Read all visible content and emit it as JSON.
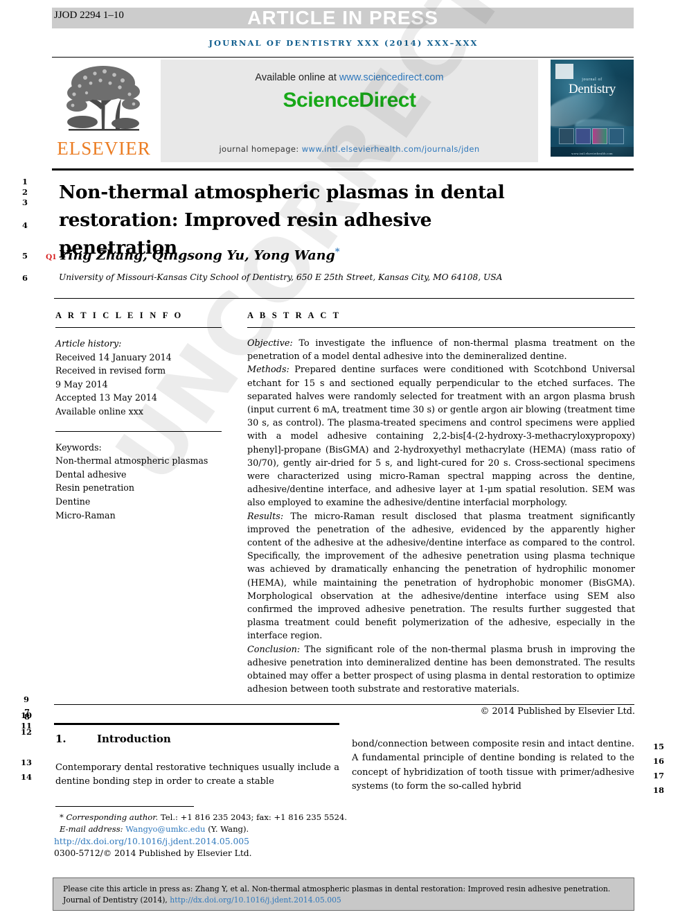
{
  "header": {
    "running_id": "JJOD 2294 1–10",
    "article_in_press": "ARTICLE IN PRESS",
    "journal_running_head": "JOURNAL OF DENTISTRY XXX (2014) XXX–XXX"
  },
  "masthead": {
    "publisher_name": "ELSEVIER",
    "available_text": "Available online at",
    "sciencedirect_url": "www.sciencedirect.com",
    "sciencedirect_logo": "ScienceDirect",
    "homepage_label": "journal homepage:",
    "homepage_url": "www.intl.elsevierhealth.com/journals/jden",
    "cover_journal_sup": "journal of",
    "cover_journal_name": "Dentistry",
    "cover_footer": "www.intl.elsevierhealth.com"
  },
  "article": {
    "title": "Non-thermal atmospheric plasmas in dental restoration: Improved resin adhesive penetration",
    "query_marker": "Q1",
    "authors": "Ying Zhang, Qingsong Yu, Yong Wang",
    "corresponding_star": "*",
    "affiliation": "University of Missouri-Kansas City School of Dentistry, 650 E 25th Street, Kansas City, MO 64108, USA"
  },
  "info": {
    "heading": "A R T I C L E   I N F O",
    "history_label": "Article history:",
    "history": [
      "Received 14 January 2014",
      "Received in revised form",
      "9 May 2014",
      "Accepted 13 May 2014",
      "Available online xxx"
    ],
    "keywords_label": "Keywords:",
    "keywords": [
      "Non-thermal atmospheric plasmas",
      "Dental adhesive",
      "Resin penetration",
      "Dentine",
      "Micro-Raman"
    ]
  },
  "abstract": {
    "heading": "A B S T R A C T",
    "objective_label": "Objective:",
    "objective_text": " To investigate the influence of non-thermal plasma treatment on the penetration of a model dental adhesive into the demineralized dentine.",
    "methods_label": "Methods:",
    "methods_text": " Prepared dentine surfaces were conditioned with Scotchbond Universal etchant for 15 s and sectioned equally perpendicular to the etched surfaces. The separated halves were randomly selected for treatment with an argon plasma brush (input current 6 mA, treatment time 30 s) or gentle argon air blowing (treatment time 30 s, as control). The plasma-treated specimens and control specimens were applied with a model adhesive containing 2,2-bis[4-(2-hydroxy-3-methacryloxypropoxy) phenyl]-propane (BisGMA) and 2-hydroxyethyl methacrylate (HEMA) (mass ratio of 30/70), gently air-dried for 5 s, and light-cured for 20 s. Cross-sectional specimens were characterized using micro-Raman spectral mapping across the dentine, adhesive/dentine interface, and adhesive layer at 1-μm spatial resolution. SEM was also employed to examine the adhesive/dentine interfacial morphology.",
    "results_label": "Results:",
    "results_text": " The micro-Raman result disclosed that plasma treatment significantly improved the penetration of the adhesive, evidenced by the apparently higher content of the adhesive at the adhesive/dentine interface as compared to the control. Specifically, the improvement of the adhesive penetration using plasma technique was achieved by dramatically enhancing the penetration of hydrophilic monomer (HEMA), while maintaining the penetration of hydrophobic monomer (BisGMA). Morphological observation at the adhesive/dentine interface using SEM also confirmed the improved adhesive penetration. The results further suggested that plasma treatment could benefit polymerization of the adhesive, especially in the interface region.",
    "conclusion_label": "Conclusion:",
    "conclusion_text": " The significant role of the non-thermal plasma brush in improving the adhesive penetration into demineralized dentine has been demonstrated. The results obtained may offer a better prospect of using plasma in dental restoration to optimize adhesion between tooth substrate and restorative materials.",
    "copyright": "© 2014 Published by Elsevier Ltd."
  },
  "body": {
    "section_number": "1.",
    "section_title": "Introduction",
    "left_column": "Contemporary dental restorative techniques usually include a dentine bonding step in order to create a stable",
    "right_column": "bond/connection between composite resin and intact dentine. A fundamental principle of dentine bonding is related to the concept of hybridization of tooth tissue with primer/adhesive systems (to form the so-called hybrid"
  },
  "footnote": {
    "star": "*",
    "corresponding_label": "Corresponding author.",
    "tel_fax": " Tel.: +1 816 235 2043; fax: +1 816 235 5524.",
    "email_label": "E-mail address:",
    "email": "Wangyo@umkc.edu",
    "email_suffix": " (Y. Wang).",
    "doi": "http://dx.doi.org/10.1016/j.jdent.2014.05.005",
    "issn": "0300-5712/© 2014 Published by Elsevier Ltd."
  },
  "cite_box": {
    "line1": "Please cite this article in press as: Zhang Y, et al. Non-thermal atmospheric plasmas in dental restoration: Improved resin adhesive penetration.",
    "line2_prefix": "Journal of Dentistry (2014), ",
    "line2_link": "http://dx.doi.org/10.1016/j.jdent.2014.05.005"
  },
  "watermark": "UNCORRECTED PROOF",
  "line_numbers": {
    "left": [
      "1",
      "2",
      "3",
      "4",
      "5",
      "6",
      "9",
      "10",
      "7",
      "8",
      "11",
      "12",
      "13",
      "14"
    ],
    "right": [
      "15",
      "16",
      "17",
      "18"
    ]
  },
  "colors": {
    "journal_blue": "#115e8e",
    "link_blue": "#2e77bb",
    "sciencedirect_green": "#17a818",
    "elsevier_orange": "#eb7c22",
    "query_red": "#d41212",
    "band_gray": "#cccccc"
  }
}
